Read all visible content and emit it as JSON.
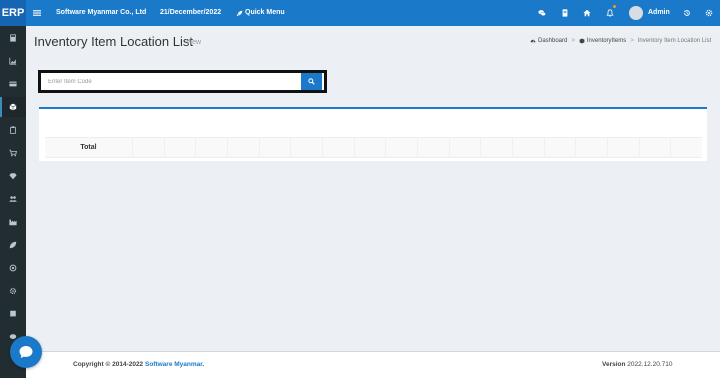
{
  "topbar": {
    "brand": "ERP",
    "company": "Software Myanmar Co., Ltd",
    "date": "21/December/2022",
    "quick_menu": "Quick Menu",
    "user": "Admin"
  },
  "page": {
    "title": "Inventory Item Location List",
    "subtitle": "View"
  },
  "breadcrumb": {
    "items": [
      "Dashboard",
      "InventoryItems",
      "Inventory Item Location List"
    ]
  },
  "search": {
    "placeholder": "Enter Item Code",
    "value": ""
  },
  "table": {
    "total_label": "Total"
  },
  "footer": {
    "copyright_prefix": "Copyright © 2014-2022 ",
    "copyright_link": "Software Myanmar",
    "copyright_suffix": ".",
    "version_label": "Version",
    "version_value": "2022.12.20.710"
  },
  "colors": {
    "primary": "#1a7ac9",
    "sidebar": "#222d32",
    "background": "#ecf0f5"
  }
}
